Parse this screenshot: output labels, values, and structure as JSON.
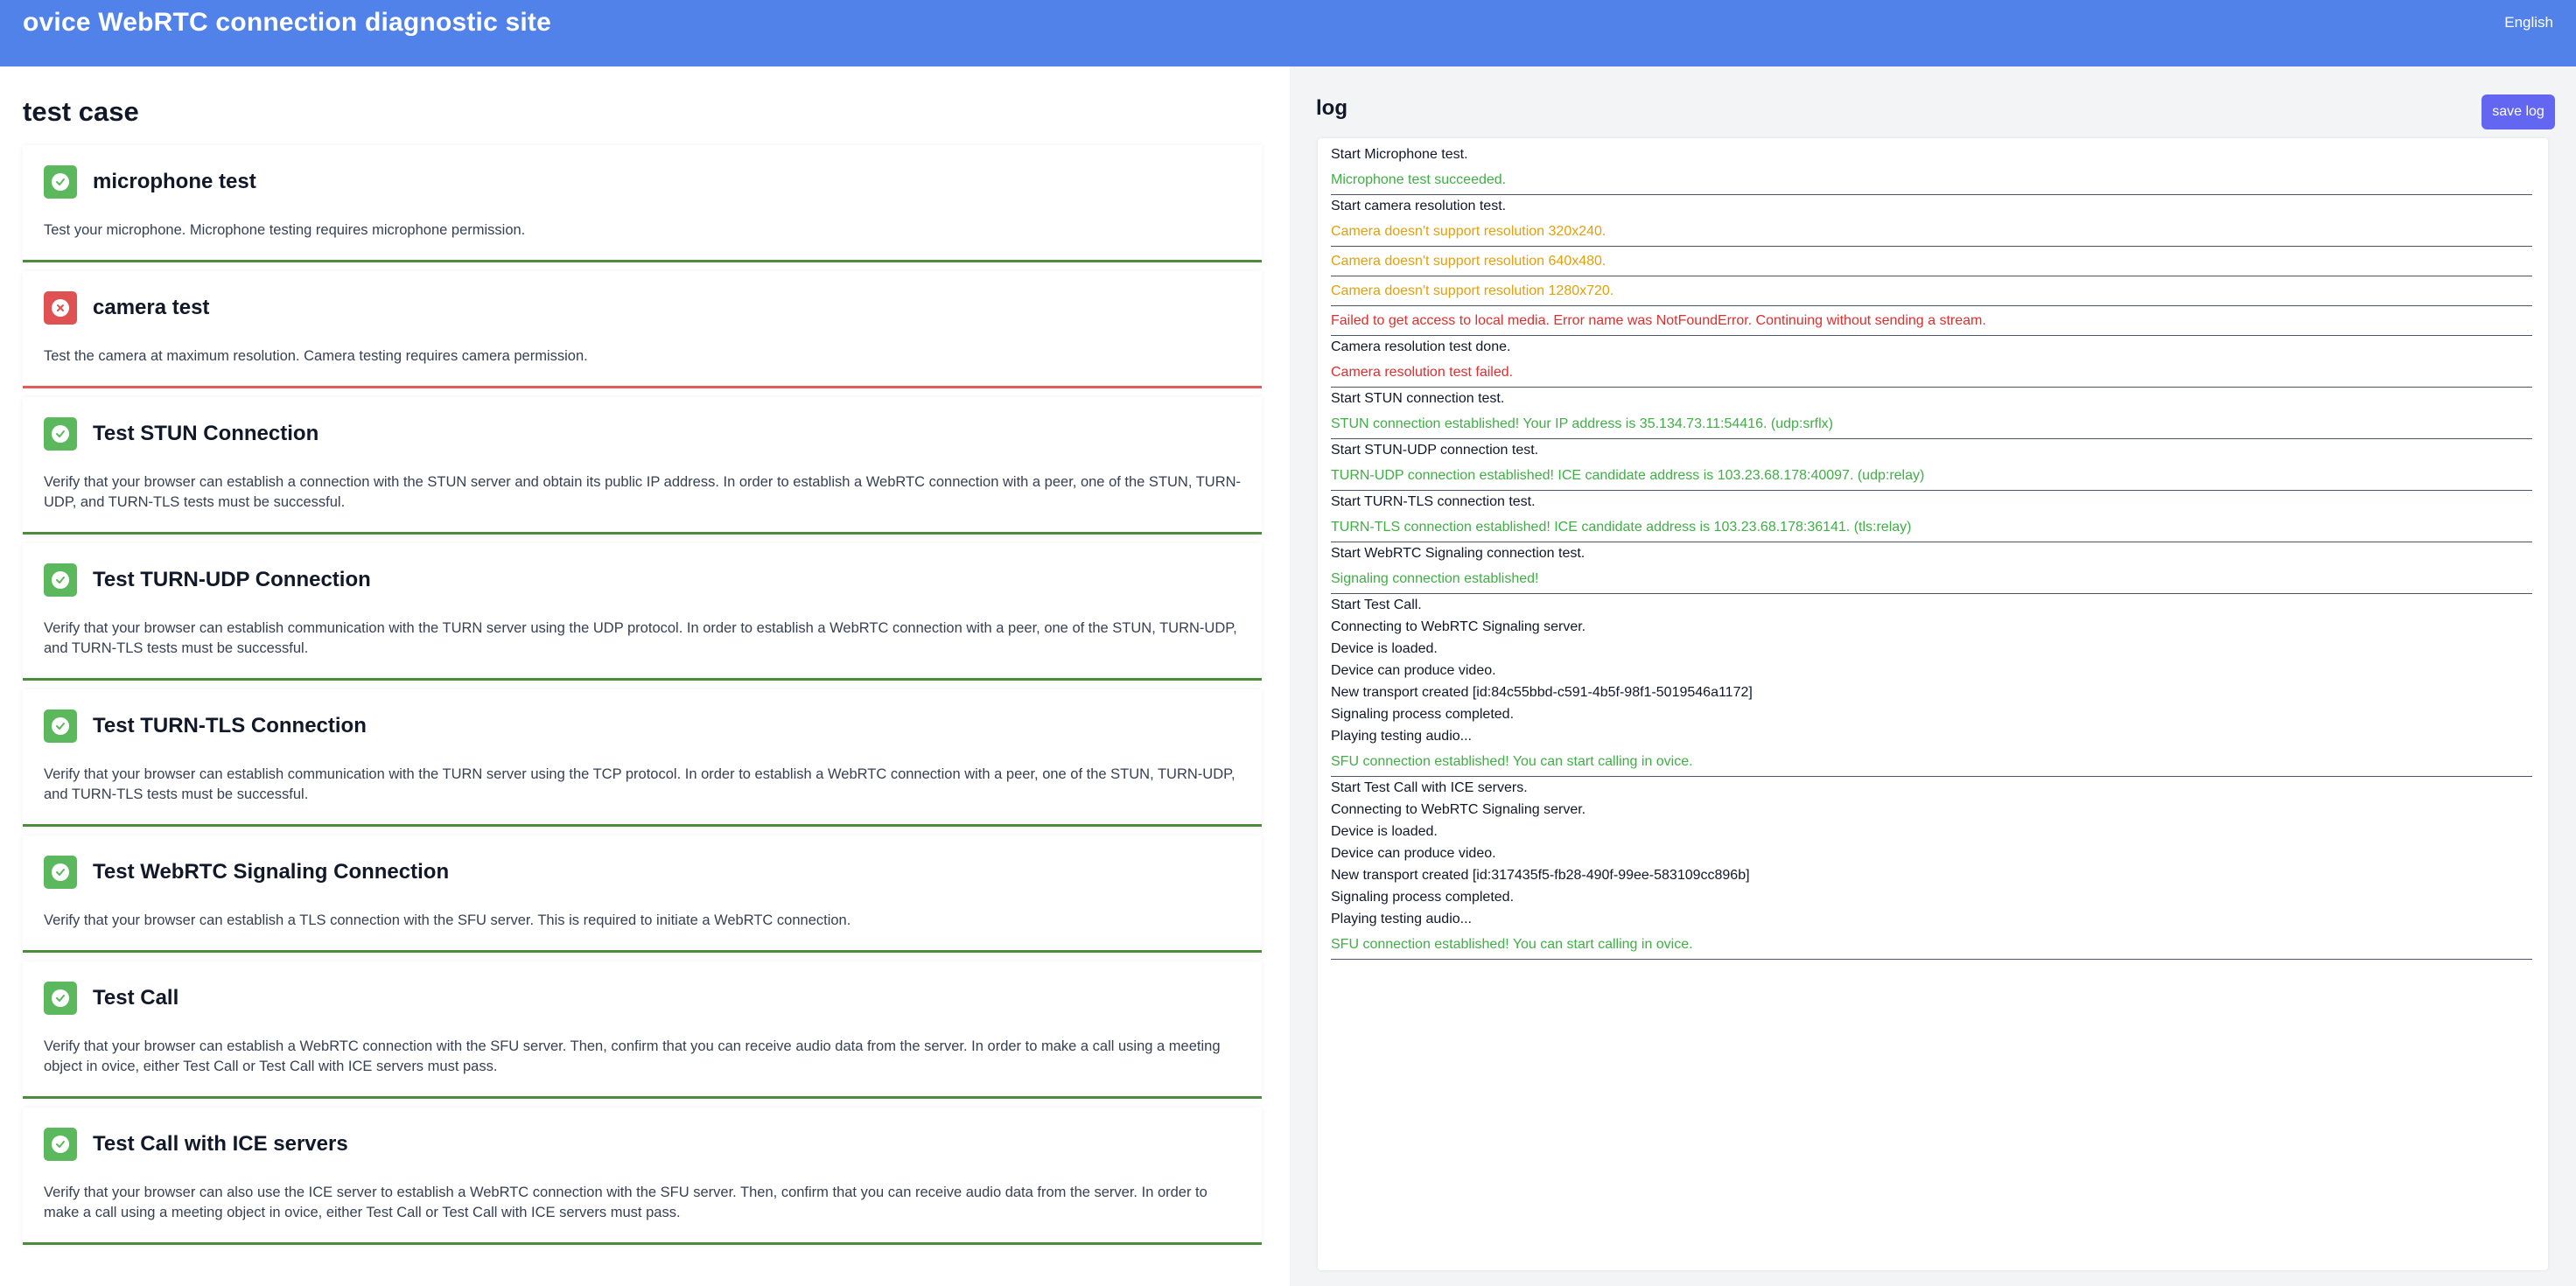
{
  "header": {
    "title": "ovice WebRTC connection diagnostic site",
    "language": "English"
  },
  "colors": {
    "header_bg": "#5082ea",
    "success": "#5cb85c",
    "failure": "#e05252",
    "button": "#6366f1"
  },
  "test_section": {
    "title": "test case",
    "cards": [
      {
        "title": "microphone test",
        "status": "success",
        "icon": "check-icon",
        "description": "Test your microphone. Microphone testing requires microphone permission."
      },
      {
        "title": "camera test",
        "status": "fail",
        "icon": "x-icon",
        "description": "Test the camera at maximum resolution. Camera testing requires camera permission."
      },
      {
        "title": "Test STUN Connection",
        "status": "success",
        "icon": "check-icon",
        "description": "Verify that your browser can establish a connection with the STUN server and obtain its public IP address. In order to establish a WebRTC connection with a peer, one of the STUN, TURN-UDP, and TURN-TLS tests must be successful."
      },
      {
        "title": "Test TURN-UDP Connection",
        "status": "success",
        "icon": "check-icon",
        "description": "Verify that your browser can establish communication with the TURN server using the UDP protocol. In order to establish a WebRTC connection with a peer, one of the STUN, TURN-UDP, and TURN-TLS tests must be successful."
      },
      {
        "title": "Test TURN-TLS Connection",
        "status": "success",
        "icon": "check-icon",
        "description": "Verify that your browser can establish communication with the TURN server using the TCP protocol. In order to establish a WebRTC connection with a peer, one of the STUN, TURN-UDP, and TURN-TLS tests must be successful."
      },
      {
        "title": "Test WebRTC Signaling Connection",
        "status": "success",
        "icon": "check-icon",
        "description": "Verify that your browser can establish a TLS connection with the SFU server. This is required to initiate a WebRTC connection."
      },
      {
        "title": "Test Call",
        "status": "success",
        "icon": "check-icon",
        "description": "Verify that your browser can establish a WebRTC connection with the SFU server. Then, confirm that you can receive audio data from the server. In order to make a call using a meeting object in ovice, either Test Call or Test Call with ICE servers must pass."
      },
      {
        "title": "Test Call with ICE servers",
        "status": "success",
        "icon": "check-icon",
        "description": "Verify that your browser can also use the ICE server to establish a WebRTC connection with the SFU server. Then, confirm that you can receive audio data from the server. In order to make a call using a meeting object in ovice, either Test Call or Test Call with ICE servers must pass."
      }
    ]
  },
  "log_section": {
    "title": "log",
    "save_label": "save log",
    "entries": [
      {
        "text": "Start Microphone test.",
        "level": "plain"
      },
      {
        "text": "Microphone test succeeded.",
        "level": "green"
      },
      {
        "text": "Start camera resolution test.",
        "level": "plain"
      },
      {
        "text": "Camera doesn't support resolution 320x240.",
        "level": "orange"
      },
      {
        "text": "Camera doesn't support resolution 640x480.",
        "level": "orange"
      },
      {
        "text": "Camera doesn't support resolution 1280x720.",
        "level": "orange"
      },
      {
        "text": "Failed to get access to local media. Error name was NotFoundError. Continuing without sending a stream.",
        "level": "red"
      },
      {
        "text": "Camera resolution test done.",
        "level": "plain"
      },
      {
        "text": "Camera resolution test failed.",
        "level": "red"
      },
      {
        "text": "Start STUN connection test.",
        "level": "plain"
      },
      {
        "text": "STUN connection established! Your IP address is 35.134.73.11:54416. (udp:srflx)",
        "level": "green"
      },
      {
        "text": "Start STUN-UDP connection test.",
        "level": "plain"
      },
      {
        "text": "TURN-UDP connection established! ICE candidate address is 103.23.68.178:40097. (udp:relay)",
        "level": "green"
      },
      {
        "text": "Start TURN-TLS connection test.",
        "level": "plain"
      },
      {
        "text": "TURN-TLS connection established! ICE candidate address is 103.23.68.178:36141. (tls:relay)",
        "level": "green"
      },
      {
        "text": "Start WebRTC Signaling connection test.",
        "level": "plain"
      },
      {
        "text": "Signaling connection established!",
        "level": "green"
      },
      {
        "text": "Start Test Call.",
        "level": "plain"
      },
      {
        "text": "Connecting to WebRTC Signaling server.",
        "level": "plain"
      },
      {
        "text": "Device is loaded.",
        "level": "plain"
      },
      {
        "text": "Device can produce video.",
        "level": "plain"
      },
      {
        "text": "New transport created [id:84c55bbd-c591-4b5f-98f1-5019546a1172]",
        "level": "plain"
      },
      {
        "text": "Signaling process completed.",
        "level": "plain"
      },
      {
        "text": "Playing testing audio...",
        "level": "plain"
      },
      {
        "text": "SFU connection established! You can start calling in ovice.",
        "level": "green"
      },
      {
        "text": "Start Test Call with ICE servers.",
        "level": "plain"
      },
      {
        "text": "Connecting to WebRTC Signaling server.",
        "level": "plain"
      },
      {
        "text": "Device is loaded.",
        "level": "plain"
      },
      {
        "text": "Device can produce video.",
        "level": "plain"
      },
      {
        "text": "New transport created [id:317435f5-fb28-490f-99ee-583109cc896b]",
        "level": "plain"
      },
      {
        "text": "Signaling process completed.",
        "level": "plain"
      },
      {
        "text": "Playing testing audio...",
        "level": "plain"
      },
      {
        "text": "SFU connection established! You can start calling in ovice.",
        "level": "green"
      }
    ]
  }
}
